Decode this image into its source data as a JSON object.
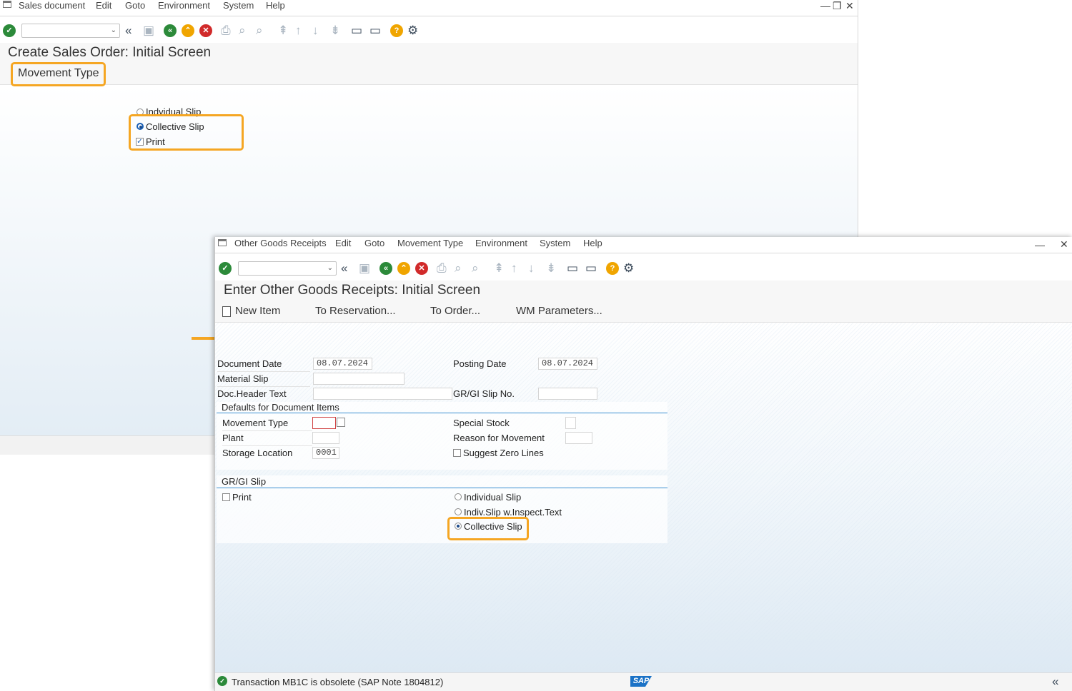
{
  "top_window": {
    "menu": [
      "Sales document",
      "Edit",
      "Goto",
      "Environment",
      "System",
      "Help"
    ],
    "window_controls": [
      "—",
      "❐",
      "✕"
    ],
    "title": "Create Sales Order: Initial Screen",
    "subtoolbar_button": "Movement Type",
    "options": {
      "individual_slip": "Indvidual Slip",
      "collective_slip": "Collective Slip",
      "print": "Print"
    }
  },
  "bottom_window": {
    "menu": [
      "Other Goods Receipts",
      "Edit",
      "Goto",
      "Movement Type",
      "Environment",
      "System",
      "Help"
    ],
    "window_controls": [
      "—",
      "✕"
    ],
    "title": "Enter Other Goods Receipts: Initial Screen",
    "app_buttons": [
      "New Item",
      "To Reservation...",
      "To Order...",
      "WM Parameters..."
    ],
    "fields": {
      "document_date_label": "Document Date",
      "document_date": "08.07.2024",
      "posting_date_label": "Posting Date",
      "posting_date": "08.07.2024",
      "material_slip_label": "Material Slip",
      "material_slip": "",
      "doc_header_text_label": "Doc.Header Text",
      "doc_header_text": "",
      "gr_gi_slip_no_label": "GR/GI Slip No.",
      "gr_gi_slip_no": ""
    },
    "defaults_group": {
      "title": "Defaults for Document Items",
      "movement_type_label": "Movement Type",
      "movement_type": "",
      "plant_label": "Plant",
      "plant": "",
      "storage_location_label": "Storage Location",
      "storage_location": "0001",
      "special_stock_label": "Special Stock",
      "reason_for_movement_label": "Reason for Movement",
      "suggest_zero_lines_label": "Suggest Zero Lines"
    },
    "slip_group": {
      "title": "GR/GI Slip",
      "print_label": "Print",
      "individual_slip": "Individual Slip",
      "indiv_slip_inspect": "Indiv.Slip w.Inspect.Text",
      "collective_slip": "Collective Slip"
    },
    "status": "Transaction MB1C is obsolete (SAP Note 1804812)",
    "sap_logo": "SAP"
  },
  "colors": {
    "highlight": "#f5a623",
    "group_line": "#3a8fd0",
    "ok_green": "#2c8a3a"
  }
}
